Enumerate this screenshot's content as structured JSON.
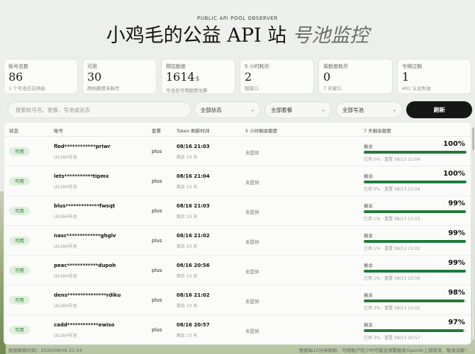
{
  "header": {
    "kicker": "PUBLIC API POOL OBSERVER",
    "title_main": "小鸡毛的公益 API 站",
    "title_accent": "号池监控"
  },
  "stats": [
    {
      "label": "账号总数",
      "value": "86",
      "unit": "",
      "note": "1 个号池正在供给"
    },
    {
      "label": "可用",
      "value": "30",
      "unit": "",
      "note": "两档额度未耗尽"
    },
    {
      "label": "预估额度",
      "value": "1614",
      "unit": "$",
      "note": "号池总可用额度估算"
    },
    {
      "label": "5 小时耗尽",
      "value": "2",
      "unit": "",
      "note": "短窗口"
    },
    {
      "label": "周额度耗尽",
      "value": "0",
      "unit": "",
      "note": "7 天窗口"
    },
    {
      "label": "令牌过期",
      "value": "1",
      "unit": "",
      "note": "401 认证失效"
    }
  ],
  "filters": {
    "search_placeholder": "搜索账号名、套餐、号池或状态",
    "status": "全部状态",
    "plan": "全部套餐",
    "pool": "全部号池",
    "refresh": "刷新"
  },
  "table": {
    "columns": {
      "status": "状态",
      "account": "账号",
      "plan": "套餐",
      "token": "Token 刷新时间",
      "five_hour": "5 小时剩余额度",
      "seven_day": "7 天剩余额度"
    },
    "rows": [
      {
        "status": "可用",
        "account": "fled************priwr",
        "pool": "US16H号池",
        "plan": "plus",
        "token_time": "08/16 21:03",
        "token_left": "剩余 10 天",
        "five_hour": "未提供",
        "remain_label": "剩余",
        "pct": "100%",
        "fill": 100,
        "detail": "已用 0% · 重置 08/13 21:04"
      },
      {
        "status": "可用",
        "account": "lets***********tipmx",
        "pool": "US16H号池",
        "plan": "plus",
        "token_time": "08/16 21:04",
        "token_left": "剩余 10 天",
        "five_hour": "未提供",
        "remain_label": "剩余",
        "pct": "100%",
        "fill": 100,
        "detail": "已用 0% · 重置 08/13 21:04"
      },
      {
        "status": "可用",
        "account": "blus*************fwsqt",
        "pool": "US16H号池",
        "plan": "plus",
        "token_time": "08/16 21:03",
        "token_left": "剩余 10 天",
        "five_hour": "未提供",
        "remain_label": "剩余",
        "pct": "99%",
        "fill": 99,
        "detail": "已用 1% · 重置 08/13 21:03"
      },
      {
        "status": "可用",
        "account": "nasc*************ghglv",
        "pool": "US16H号池",
        "plan": "plus",
        "token_time": "08/16 21:02",
        "token_left": "剩余 10 天",
        "five_hour": "未提供",
        "remain_label": "剩余",
        "pct": "99%",
        "fill": 99,
        "detail": "已用 1% · 重置 08/13 21:02"
      },
      {
        "status": "可用",
        "account": "peac************dupoh",
        "pool": "US16H号池",
        "plan": "plus",
        "token_time": "08/16 20:56",
        "token_left": "剩余 10 天",
        "five_hour": "未提供",
        "remain_label": "剩余",
        "pct": "99%",
        "fill": 99,
        "detail": "已用 1% · 重置 08/13 20:56"
      },
      {
        "status": "可用",
        "account": "dens***************rdiku",
        "pool": "US16H号池",
        "plan": "plus",
        "token_time": "08/16 21:02",
        "token_left": "剩余 10 天",
        "five_hour": "未提供",
        "remain_label": "剩余",
        "pct": "98%",
        "fill": 98,
        "detail": "已用 2% · 重置 08/13 21:02"
      },
      {
        "status": "可用",
        "account": "cadd************ewiso",
        "pool": "US16H号池",
        "plan": "plus",
        "token_time": "08/16 20:57",
        "token_left": "剩余 10 天",
        "five_hour": "未提供",
        "remain_label": "剩余",
        "pct": "97%",
        "fill": 97,
        "detail": "已用 3% · 重置 08/13 20:57"
      }
    ]
  },
  "footer": {
    "left": "数据刷新时间：2026/08/06 21:04",
    "right": "数据每10分钟刷新，可用账户较少时可能会频繁触发OpenAI上游限流，敬请谅解！"
  },
  "colors": {
    "accent": "#161616",
    "ok": "#2e7d32",
    "bar": "#1f7a3a"
  }
}
